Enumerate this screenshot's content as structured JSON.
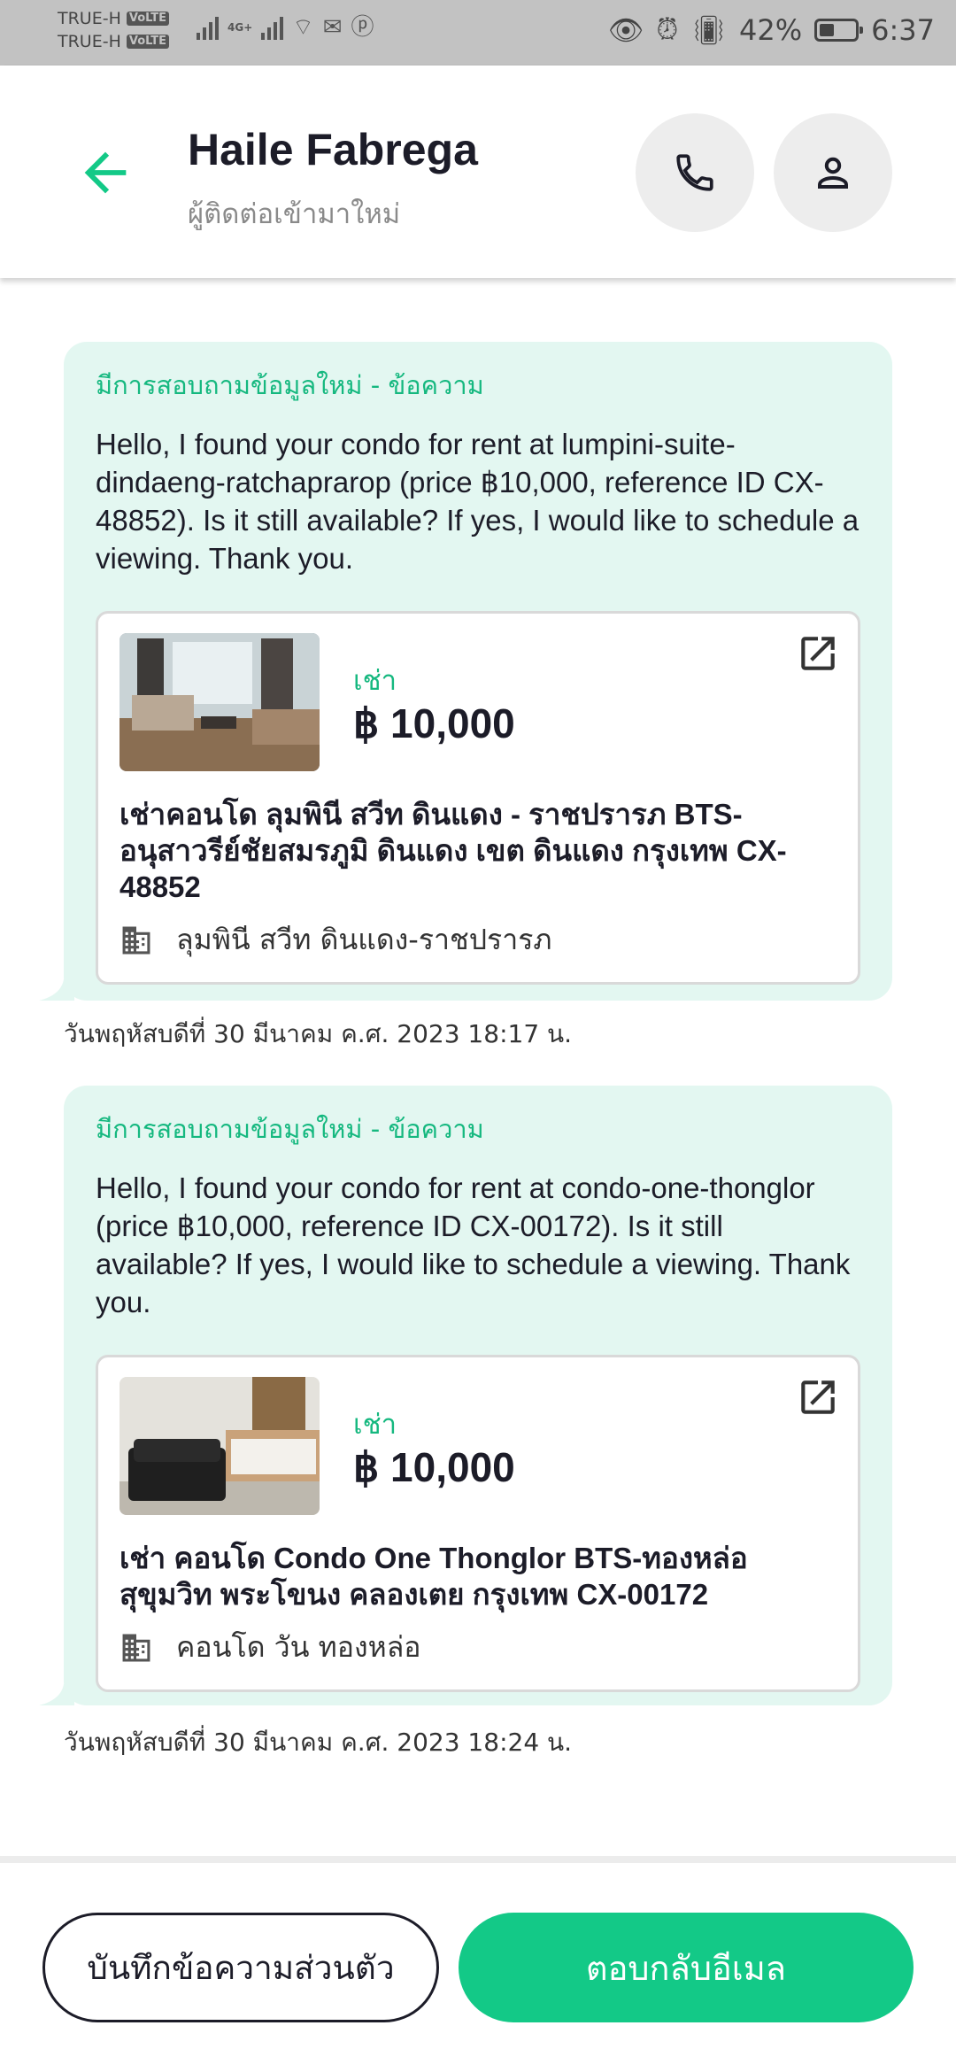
{
  "status_bar": {
    "carrier_1": "TRUE-H",
    "carrier_2": "TRUE-H",
    "volte": "VoLTE",
    "network": "4G+",
    "battery": "42%",
    "battery_level": 0.42,
    "time": "6:37"
  },
  "header": {
    "name": "Haile Fabrega",
    "subtitle": "ผู้ติดต่อเข้ามาใหม่"
  },
  "messages": [
    {
      "header": "มีการสอบถามข้อมูลใหม่ - ข้อความ",
      "text": "Hello, I found your condo for rent at lumpini-suite-dindaeng-ratchaprarop (price ฿10,000, reference ID CX-48852). Is it still available? If yes, I would like to schedule a viewing. Thank you.",
      "card": {
        "rent_label": "เช่า",
        "price": "฿ 10,000",
        "title": "เช่าคอนโด  ลุมพินี สวีท ดินแดง - ราชปรารภ BTS-อนุสาวรีย์ชัยสมรภูมิ ดินแดง เขต ดินแดง กรุงเทพ CX-48852",
        "project": "ลุมพินี สวีท ดินแดง-ราชปรารภ"
      },
      "timestamp": "วันพฤหัสบดีที่ 30 มีนาคม ค.ศ. 2023 18:17 น."
    },
    {
      "header": "มีการสอบถามข้อมูลใหม่ - ข้อความ",
      "text": "Hello, I found your condo for rent at condo-one-thonglor (price ฿10,000, reference ID CX-00172). Is it still available? If yes, I would like to schedule a viewing. Thank you.",
      "card": {
        "rent_label": "เช่า",
        "price": "฿ 10,000",
        "title": "เช่า คอนโด  Condo One Thonglor BTS-ทองหล่อ สุขุมวิท พระโขนง คลองเตย กรุงเทพ CX-00172",
        "project": "คอนโด วัน ทองหล่อ"
      },
      "timestamp": "วันพฤหัสบดีที่ 30 มีนาคม ค.ศ. 2023 18:24 น."
    }
  ],
  "actions": {
    "note_label": "บันทึกข้อความส่วนตัว",
    "reply_label": "ตอบกลับอีเมล"
  },
  "colors": {
    "accent": "#13c987",
    "bubble": "#e3f7f1",
    "accent_text": "#15b87f"
  }
}
